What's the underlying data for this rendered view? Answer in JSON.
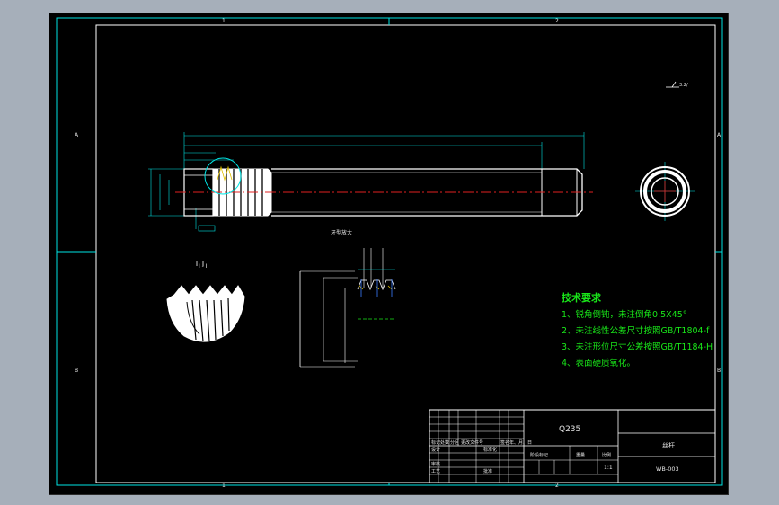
{
  "colors": {
    "background": "#a6afba",
    "paper": "#000000",
    "frame": "#00e5e5",
    "outline": "#ffffff",
    "centerline": "#e02020",
    "notes": "#19e619"
  },
  "border_zones": {
    "top": [
      "1",
      "2"
    ],
    "bottom": [
      "1",
      "2"
    ],
    "left": [
      "A",
      "B"
    ],
    "right": [
      "A",
      "B"
    ]
  },
  "roughness_symbol": "3.2/",
  "section_label": "I - I",
  "thread_detail_label": "牙型放大",
  "tech_notes": {
    "title": "技术要求",
    "items": [
      "1、锐角倒钝，未注倒角0.5X45°",
      "2、未注线性公差尺寸按照GB/T1804-f",
      "3、未注形位尺寸公差按照GB/T1184-H",
      "4、表面硬质氧化。"
    ]
  },
  "title_block": {
    "material": "Q235",
    "part_name": "丝杆",
    "drawing_no": "WB-003",
    "scale": "1:1",
    "labels": [
      "标记",
      "处数",
      "分区",
      "更改文件号",
      "签名",
      "年、月、日",
      "设计",
      "标准化",
      "审核",
      "工艺",
      "批准",
      "阶段标记",
      "重量",
      "比例"
    ]
  }
}
